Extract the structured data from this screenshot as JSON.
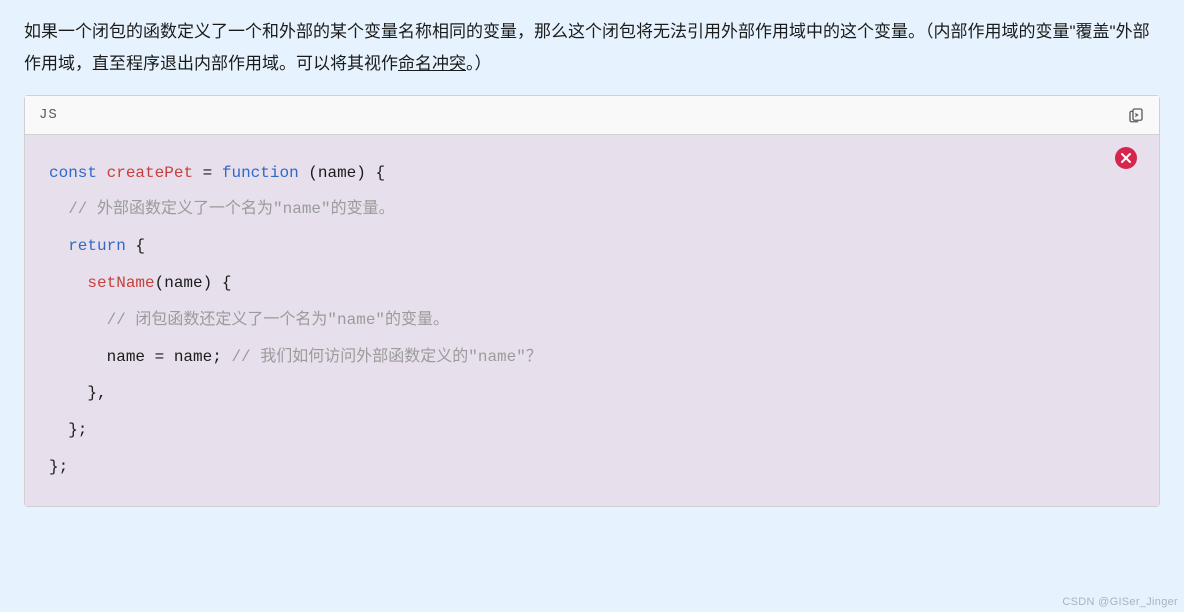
{
  "paragraph": {
    "part1": "如果一个闭包的函数定义了一个和外部的某个变量名称相同的变量，那么这个闭包将无法引用外部作用域中的这个变量。（内部作用域的变量\"覆盖\"外部作用域，直至程序退出内部作用域。可以将其视作",
    "link_text": "命名冲突",
    "part2": "。）"
  },
  "code": {
    "language_label": "JS",
    "tokens": {
      "kw_const": "const",
      "fn_createPet": "createPet",
      "eq1": " = ",
      "kw_function": "function",
      "sig_open": " (name) {",
      "cmt_outer": "// 外部函数定义了一个名为\"name\"的变量。",
      "kw_return": "return",
      "brace_open": " {",
      "fn_setName": "setName",
      "setname_sig": "(name) {",
      "cmt_inner": "// 闭包函数还定义了一个名为\"name\"的变量。",
      "assign": "name = name; ",
      "cmt_q": "// 我们如何访问外部函数定义的\"name\"？",
      "close_fn": "},",
      "close_obj": "};",
      "close_outer": "};"
    }
  },
  "watermark": "CSDN @GISer_Jinger"
}
